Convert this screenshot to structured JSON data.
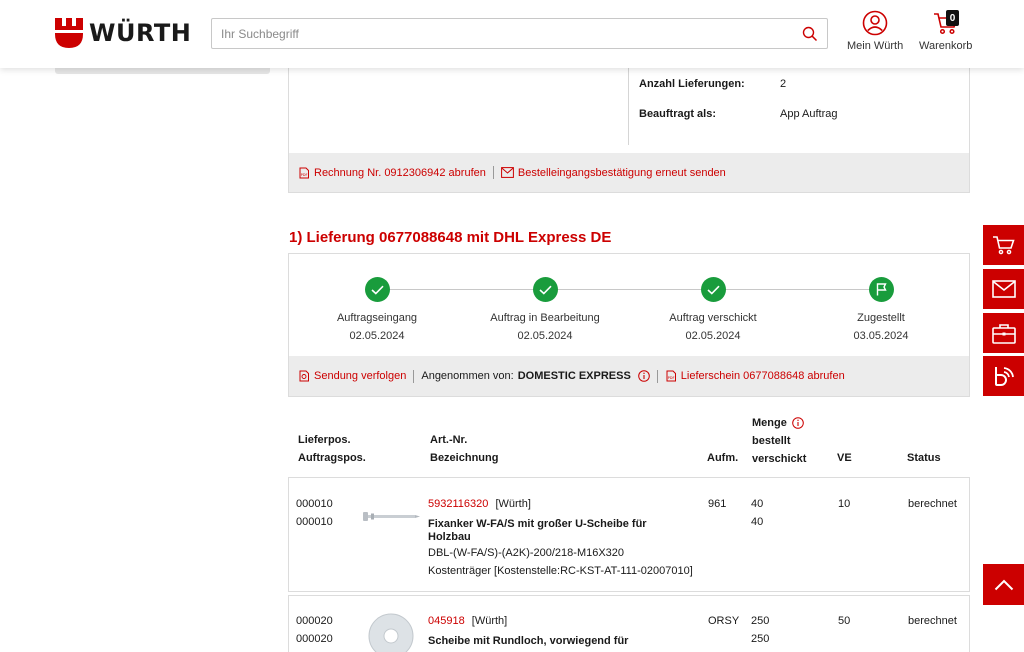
{
  "header": {
    "logo_text": "WÜRTH",
    "search_placeholder": "Ihr Suchbegriff",
    "account_label": "Mein Würth",
    "cart_label": "Warenkorb",
    "cart_count": "0"
  },
  "order": {
    "info": [
      {
        "key": "Anzahl Lieferungen:",
        "value": "2"
      },
      {
        "key": "Beauftragt als:",
        "value": "App Auftrag"
      }
    ],
    "invoice_link": "Rechnung Nr. 0912306942 abrufen",
    "resend_link": "Bestelleingangsbestätigung erneut senden"
  },
  "delivery": {
    "title": "1) Lieferung 0677088648 mit DHL Express DE",
    "steps": [
      {
        "label": "Auftragseingang",
        "date": "02.05.2024",
        "icon": "check-icon"
      },
      {
        "label": "Auftrag in Bearbeitung",
        "date": "02.05.2024",
        "icon": "check-icon"
      },
      {
        "label": "Auftrag verschickt",
        "date": "02.05.2024",
        "icon": "check-icon"
      },
      {
        "label": "Zugestellt",
        "date": "03.05.2024",
        "icon": "flag-icon"
      }
    ],
    "track_link": "Sendung verfolgen",
    "accepted_prefix": "Angenommen von:",
    "accepted_by": "DOMESTIC EXPRESS",
    "delivery_note_link": "Lieferschein 0677088648 abrufen"
  },
  "table": {
    "headers": {
      "pos_line1": "Lieferpos.",
      "pos_line2": "Auftragspos.",
      "art_line1": "Art.-Nr.",
      "art_line2": "Bezeichnung",
      "aufm": "Aufm.",
      "menge": "Menge",
      "bestellt": "bestellt",
      "verschickt": "verschickt",
      "ve": "VE",
      "status": "Status"
    },
    "rows": [
      {
        "lieferpos": "000010",
        "auftragspos": "000010",
        "art_nr": "5932116320",
        "brand": "[Würth]",
        "name_line1": "Fixanker W-FA/S mit großer U-Scheibe für",
        "name_line2": "Holzbau",
        "detail": "DBL-(W-FA/S)-(A2K)-200/218-M16X320",
        "cost": "Kostenträger [Kostenstelle:RC-KST-AT-111-02007010]",
        "aufm": "961",
        "bestellt": "40",
        "verschickt": "40",
        "ve": "10",
        "status": "berechnet"
      },
      {
        "lieferpos": "000020",
        "auftragspos": "000020",
        "art_nr": "045918",
        "brand": "[Würth]",
        "name_line1": "Scheibe mit Rundloch, vorwiegend für",
        "aufm": "ORSY",
        "bestellt": "250",
        "verschickt": "250",
        "ve": "50",
        "status": "berechnet"
      }
    ]
  },
  "colors": {
    "brand_red": "#cc0000",
    "status_green": "#199c3c",
    "footer_gray": "#ececec"
  }
}
